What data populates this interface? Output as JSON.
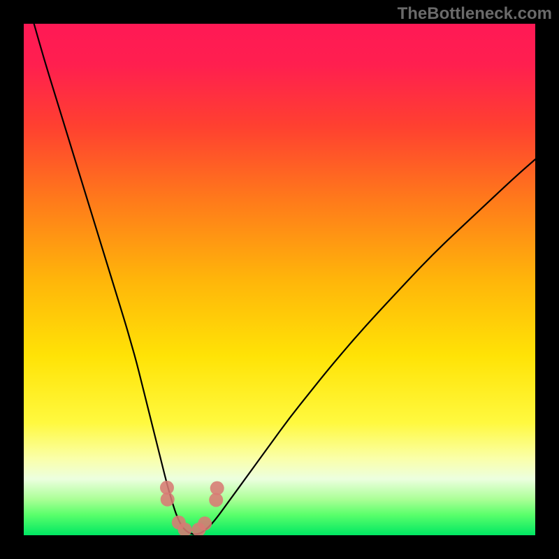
{
  "watermark": "TheBottleneck.com",
  "chart_data": {
    "type": "line",
    "title": "",
    "xlabel": "",
    "ylabel": "",
    "xlim": [
      0,
      100
    ],
    "ylim": [
      0,
      100
    ],
    "legend": false,
    "grid": false,
    "background_gradient_stops": [
      {
        "pos": 0.0,
        "color": "#ff1955"
      },
      {
        "pos": 0.08,
        "color": "#ff1f4f"
      },
      {
        "pos": 0.2,
        "color": "#ff4030"
      },
      {
        "pos": 0.35,
        "color": "#ff7c1a"
      },
      {
        "pos": 0.5,
        "color": "#ffb50a"
      },
      {
        "pos": 0.65,
        "color": "#ffe306"
      },
      {
        "pos": 0.78,
        "color": "#fff93f"
      },
      {
        "pos": 0.85,
        "color": "#faffa9"
      },
      {
        "pos": 0.89,
        "color": "#ecffdf"
      },
      {
        "pos": 0.93,
        "color": "#aaff96"
      },
      {
        "pos": 0.96,
        "color": "#5aff6b"
      },
      {
        "pos": 1.0,
        "color": "#00e763"
      }
    ],
    "series": [
      {
        "name": "bottleneck-curve",
        "stroke": "#000000",
        "stroke_width": 2.2,
        "x": [
          2,
          4,
          6,
          8,
          10,
          12,
          14,
          16,
          18,
          20,
          21,
          22,
          23,
          24,
          25,
          26,
          27,
          28,
          29,
          30,
          31,
          32,
          33,
          34,
          35,
          37,
          40,
          44,
          48,
          52,
          56,
          60,
          66,
          72,
          80,
          88,
          96,
          100
        ],
        "y": [
          100,
          93,
          86.5,
          80,
          73.5,
          67,
          60.5,
          54,
          47.5,
          41,
          37.5,
          34,
          30,
          26,
          22,
          18,
          14,
          10,
          6.5,
          3.5,
          1.6,
          0.6,
          0.2,
          0.2,
          0.6,
          2.4,
          6.5,
          12,
          17.5,
          23,
          28,
          33,
          40,
          46.5,
          55,
          62.5,
          70,
          73.5
        ]
      }
    ],
    "markers": [
      {
        "x": 28.0,
        "y": 9.3
      },
      {
        "x": 28.1,
        "y": 7.0
      },
      {
        "x": 30.3,
        "y": 2.5
      },
      {
        "x": 31.5,
        "y": 1.1
      },
      {
        "x": 34.2,
        "y": 1.1
      },
      {
        "x": 35.4,
        "y": 2.3
      },
      {
        "x": 37.6,
        "y": 6.9
      },
      {
        "x": 37.8,
        "y": 9.2
      }
    ],
    "marker_style": {
      "r": 10,
      "fill": "#d87a74",
      "fill_opacity": 0.88
    }
  }
}
